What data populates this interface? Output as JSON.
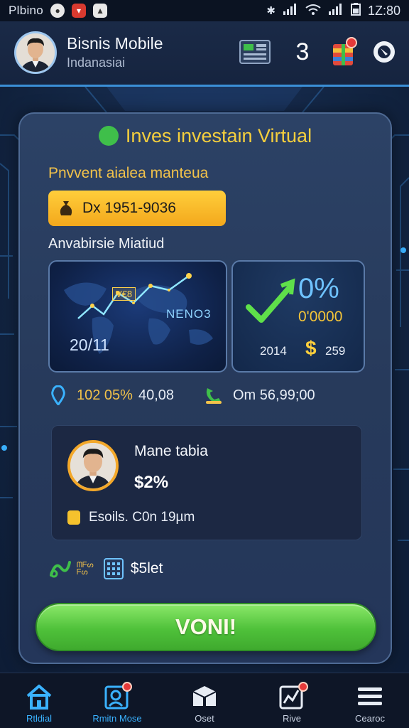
{
  "status_bar": {
    "carrier": "Plbino",
    "time": "1Z:80"
  },
  "header": {
    "app_title": "Bisnis Mobile",
    "app_subtitle": "Indanasiai",
    "count": "3",
    "icons": [
      "calculator-icon",
      "gift-icon",
      "settings-icon"
    ]
  },
  "card": {
    "title": "Inves investain Virtual",
    "subtitle": "Pnvvent aialea manteua",
    "amount": "Dx 1951-9036",
    "section_label": "Anvabirsie Miatiud",
    "tile1": {
      "mini_label": "V€8",
      "tag": "NENO3",
      "year": "20/11"
    },
    "tile2": {
      "percent": "0%",
      "value": "0'0000",
      "year": "2014",
      "dollar": "$",
      "number": "259"
    },
    "stat1": {
      "highlight": "102 05%",
      "value": "40,08"
    },
    "stat2": {
      "value": "Om 56,99;00"
    },
    "profile": {
      "name": "Mane tabia",
      "percent": "$2%",
      "info": "Esoils. C0n 19µm"
    },
    "tools": {
      "mini_text_1": "ᗰᖴᔕ",
      "mini_text_2": "ᖴᔕ",
      "label": "$5let"
    },
    "cta_label": "VONI!"
  },
  "bottom_nav": [
    {
      "label": "Rtldial",
      "icon": "home-icon",
      "active": true
    },
    {
      "label": "Rmitn Mose",
      "icon": "profile-search-icon",
      "active": true
    },
    {
      "label": "Oset",
      "icon": "box-icon",
      "active": false
    },
    {
      "label": "Rive",
      "icon": "chart-icon",
      "active": false
    },
    {
      "label": "Cearoc",
      "icon": "menu-icon",
      "active": false
    }
  ],
  "colors": {
    "accent_gold": "#f5cf3d",
    "cta_green": "#4fc13a",
    "active_blue": "#3ab2ff",
    "badge_red": "#e63a3a"
  }
}
